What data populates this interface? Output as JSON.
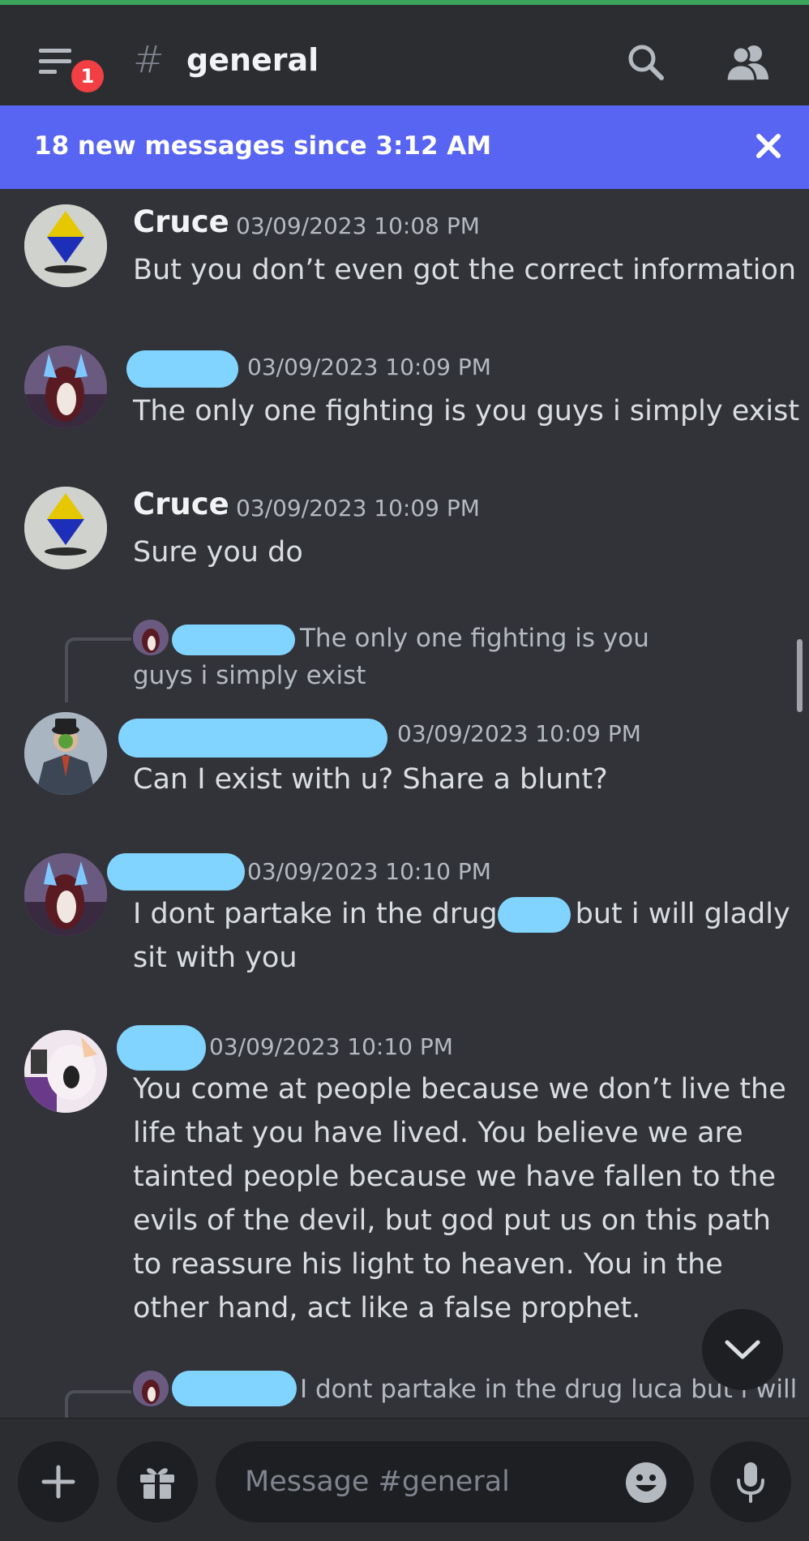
{
  "header": {
    "notification_count": "1",
    "hash_symbol": "#",
    "channel_name": "general"
  },
  "banner": {
    "text": "18 new messages since 3:12 AM"
  },
  "messages": [
    {
      "author": "Cruce",
      "timestamp": "03/09/2023 10:08 PM",
      "text": "But you don’t even got the correct information"
    },
    {
      "author": "",
      "timestamp": "03/09/2023 10:09 PM",
      "text": "The only one fighting is you guys i simply exist"
    },
    {
      "author": "Cruce",
      "timestamp": "03/09/2023 10:09 PM",
      "text": "Sure you do"
    },
    {
      "reply_to": "The only one fighting is you guys i simply exist",
      "author": "",
      "timestamp": "03/09/2023 10:09 PM",
      "text": "Can I exist with u? Share a blunt?"
    },
    {
      "author": "",
      "timestamp": "03/09/2023 10:10 PM",
      "text_before": "I dont partake in the drug",
      "text_after": "but i will gladly",
      "text_line2": "sit with you"
    },
    {
      "author": "",
      "timestamp": "03/09/2023 10:10 PM",
      "text": "You come at people because we don’t live the life that you have lived. You believe we are tainted people because we have fallen to the evils of the devil, but god put us on this path to reassure his light to heaven. You in the other hand, act like a false prophet."
    },
    {
      "reply_to": "I dont partake in the drug luca but i will"
    }
  ],
  "composer": {
    "placeholder": "Message #general"
  },
  "colors": {
    "background": "#313338",
    "header": "#2b2d31",
    "banner": "#5865f2",
    "redaction": "#80d4ff",
    "badge": "#f23f43"
  },
  "icons": [
    "menu-icon",
    "search-icon",
    "members-icon",
    "close-icon",
    "chevron-down-icon",
    "plus-icon",
    "gift-icon",
    "emoji-icon",
    "microphone-icon"
  ]
}
